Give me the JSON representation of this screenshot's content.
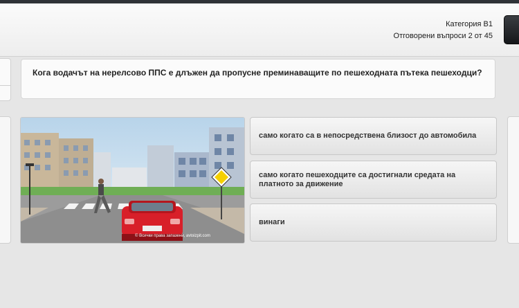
{
  "header": {
    "category": "Категория В1",
    "progress": "Отговорени въпроси 2 от 45"
  },
  "question": {
    "text": "Кога водачът на нерелсово ППС е длъжен да пропусне преминаващите по пешеходната пътека пешеходци?"
  },
  "image": {
    "watermark": "© Всички права запазени, avtoizpit.com"
  },
  "answers": [
    {
      "label": "само когато са в непосредствена близост до автомобила"
    },
    {
      "label": "само когато пешеходците са достигнали средата на платното за движение"
    },
    {
      "label": "винаги"
    }
  ],
  "colors": {
    "header_bg": "#f4f4f4",
    "page_bg": "#e6e6e6",
    "car": "#e0202a",
    "sign_yellow": "#f5d000"
  }
}
